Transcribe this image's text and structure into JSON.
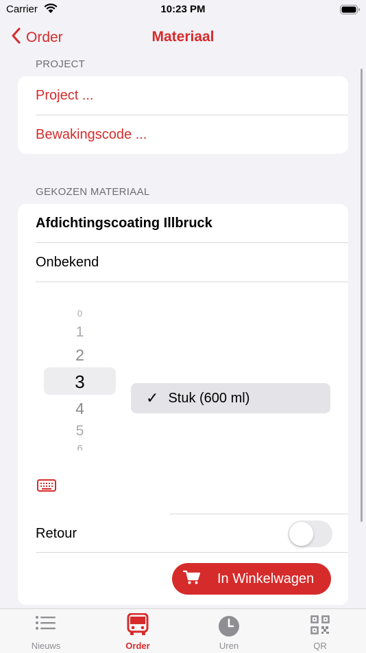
{
  "status_bar": {
    "carrier": "Carrier",
    "time": "10:23 PM"
  },
  "nav": {
    "back_label": "Order",
    "title": "Materiaal"
  },
  "project_section": {
    "header": "PROJECT",
    "project_label": "Project ...",
    "code_label": "Bewakingscode ..."
  },
  "material_section": {
    "header": "GEKOZEN MATERIAAL",
    "name": "Afdichtingscoating Illbruck",
    "status": "Onbekend",
    "quantity_picker": {
      "values": [
        "0",
        "1",
        "2",
        "3",
        "4",
        "5",
        "6"
      ],
      "selected": "3"
    },
    "unit_option": {
      "check": "✓",
      "label": "Stuk (600 ml)"
    },
    "retour_label": "Retour",
    "retour_enabled": false,
    "cart_button_label": "In Winkelwagen"
  },
  "tabs": [
    {
      "label": "Nieuws",
      "icon": "list-icon",
      "active": false
    },
    {
      "label": "Order",
      "icon": "bus-icon",
      "active": true
    },
    {
      "label": "Uren",
      "icon": "clock-icon",
      "active": false
    },
    {
      "label": "QR",
      "icon": "qr-icon",
      "active": false
    }
  ],
  "colors": {
    "accent": "#d62b2b",
    "background": "#f2f2f7",
    "tab_inactive": "#8e8e93"
  }
}
